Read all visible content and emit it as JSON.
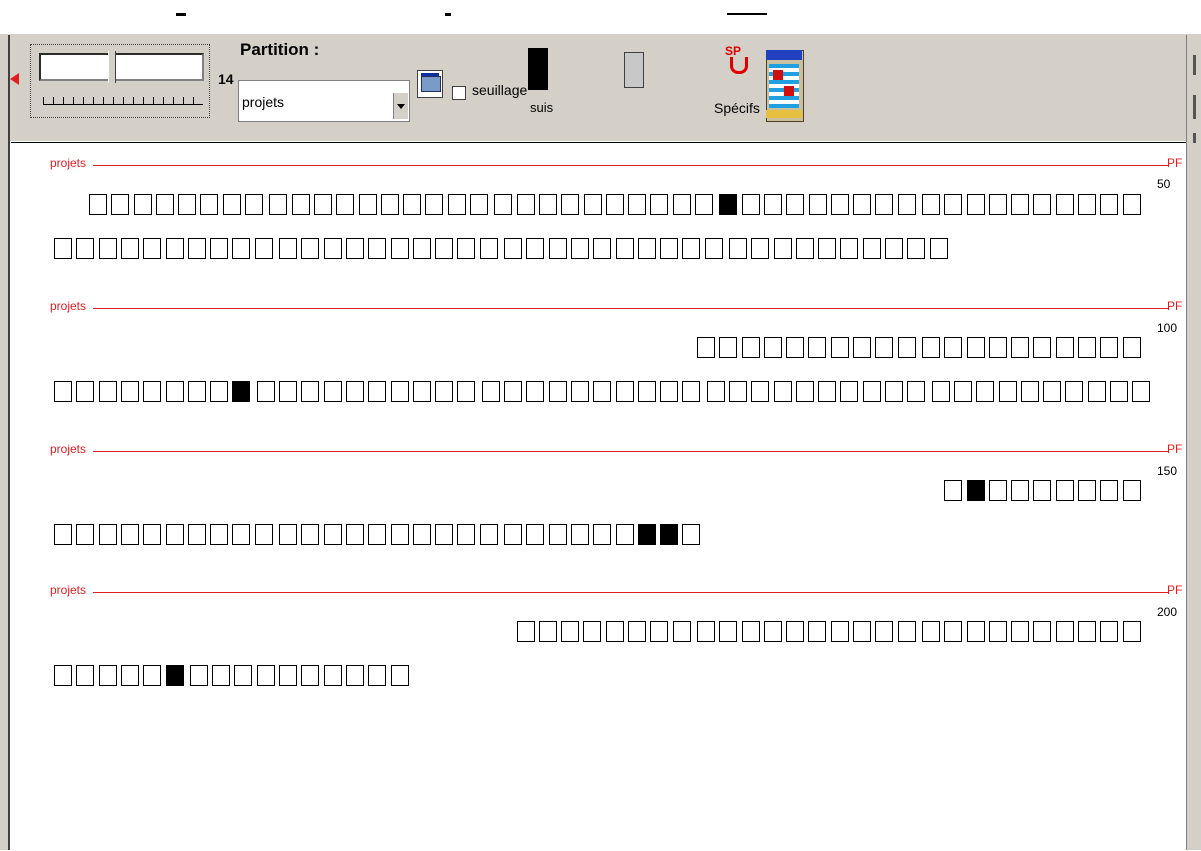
{
  "toolbar": {
    "zoom_value": "14",
    "partition_label": "Partition :",
    "partition_value": "projets",
    "seuillage_label": "seuillage",
    "suis_label": "suis",
    "specifs_label": "Spécifs",
    "sp_badge": "SP"
  },
  "sections": [
    {
      "label": "projets",
      "pf": "PF",
      "count": "50"
    },
    {
      "label": "projets",
      "pf": "PF",
      "count": "100"
    },
    {
      "label": "projets",
      "pf": "PF",
      "count": "150"
    },
    {
      "label": "projets",
      "pf": "PF",
      "count": "200"
    }
  ],
  "glyph_rows": [
    {
      "section": 0,
      "line": 0,
      "cells": "oooooooo_oooooooooo_oooooooooo_xoooooooo_oooooooooo"
    },
    {
      "section": 0,
      "line": 1,
      "cells": "oooooooooo_oooooooooo_oooooooooo_oooooooooo"
    },
    {
      "section": 1,
      "line": 0,
      "cells": "oooooooooo_oooooooooo"
    },
    {
      "section": 1,
      "line": 1,
      "cells": "oooooooox_oooooooooo_oooooooooo_oooooooooo_oooooooooo"
    },
    {
      "section": 2,
      "line": 0,
      "cells": "oxooooooo"
    },
    {
      "section": 2,
      "line": 1,
      "cells": "oooooooooo_oooooooooo_ooooooxxo"
    },
    {
      "section": 3,
      "line": 0,
      "cells": "oooooooo_oooooooooo_oooooooooo"
    },
    {
      "section": 3,
      "line": 1,
      "cells": "ooooox_oooooooooo"
    }
  ]
}
